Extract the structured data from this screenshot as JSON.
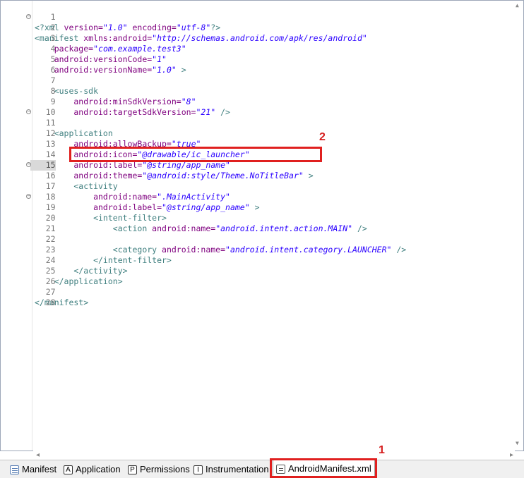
{
  "editor": {
    "lines": [
      {
        "n": "1"
      },
      {
        "n": "2"
      },
      {
        "n": "3"
      },
      {
        "n": "4"
      },
      {
        "n": "5"
      },
      {
        "n": "6"
      },
      {
        "n": "7"
      },
      {
        "n": "8"
      },
      {
        "n": "9"
      },
      {
        "n": "10"
      },
      {
        "n": "11"
      },
      {
        "n": "12"
      },
      {
        "n": "13"
      },
      {
        "n": "14"
      },
      {
        "n": "15"
      },
      {
        "n": "16"
      },
      {
        "n": "17"
      },
      {
        "n": "18"
      },
      {
        "n": "19"
      },
      {
        "n": "20"
      },
      {
        "n": "21"
      },
      {
        "n": "22"
      },
      {
        "n": "23"
      },
      {
        "n": "24"
      },
      {
        "n": "25"
      },
      {
        "n": "26"
      },
      {
        "n": "27"
      },
      {
        "n": "28"
      }
    ],
    "code": {
      "l1": {
        "a": "<?xml",
        "b": " version=",
        "c": "\"1.0\"",
        "d": " encoding=",
        "e": "\"utf-8\"",
        "f": "?>"
      },
      "l2": {
        "a": "<manifest",
        "b": " xmlns:android=",
        "c": "\"http://schemas.android.com/apk/res/android\""
      },
      "l3": {
        "a": "    package=",
        "b": "\"com.example.test3\""
      },
      "l4": {
        "a": "    android:versionCode=",
        "b": "\"1\""
      },
      "l5": {
        "a": "    android:versionName=",
        "b": "\"1.0\"",
        "c": " >"
      },
      "l7": {
        "a": "    <uses-sdk"
      },
      "l8": {
        "a": "        android:minSdkVersion=",
        "b": "\"8\""
      },
      "l9": {
        "a": "        android:targetSdkVersion=",
        "b": "\"21\"",
        "c": " />"
      },
      "l11": {
        "a": "    <application"
      },
      "l12": {
        "a": "        android:allowBackup=",
        "b": "\"true\""
      },
      "l13": {
        "a": "        android:icon=",
        "b": "\"@drawable/ic_launcher\""
      },
      "l14": {
        "a": "        android:label=",
        "b": "\"@string/app_name\""
      },
      "l15": {
        "a": "        android:theme=",
        "b": "\"@android:style/Theme.NoTitleBar\"",
        "c": " >"
      },
      "l16": {
        "a": "        <activity"
      },
      "l17": {
        "a": "            android:name=",
        "b": "\".MainActivity\""
      },
      "l18": {
        "a": "            android:label=",
        "b": "\"@string/app_name\"",
        "c": " >"
      },
      "l19": {
        "a": "            <intent-filter>"
      },
      "l20": {
        "a": "                <action",
        "b": " android:name=",
        "c": "\"android.intent.action.MAIN\"",
        "d": " />"
      },
      "l22": {
        "a": "                <category",
        "b": " android:name=",
        "c": "\"android.intent.category.LAUNCHER\"",
        "d": " />"
      },
      "l23": {
        "a": "            </intent-filter>"
      },
      "l24": {
        "a": "        </activity>"
      },
      "l25": {
        "a": "    </application>"
      },
      "l27": {
        "a": "</manifest>"
      }
    }
  },
  "tabs": [
    {
      "label": "Manifest",
      "icon": "grid-icon"
    },
    {
      "label": "Application",
      "icon": "a-icon",
      "glyph": "A"
    },
    {
      "label": "Permissions",
      "icon": "p-icon",
      "glyph": "P"
    },
    {
      "label": "Instrumentation",
      "icon": "i-icon",
      "glyph": "I"
    },
    {
      "label": "AndroidManifest.xml",
      "icon": "xml-file-icon"
    }
  ],
  "annotations": {
    "one": "1",
    "two": "2"
  },
  "colors": {
    "highlight": "#e0201f",
    "tag": "#3f7f7f",
    "attribute": "#7f007f",
    "value": "#2a00ff"
  }
}
